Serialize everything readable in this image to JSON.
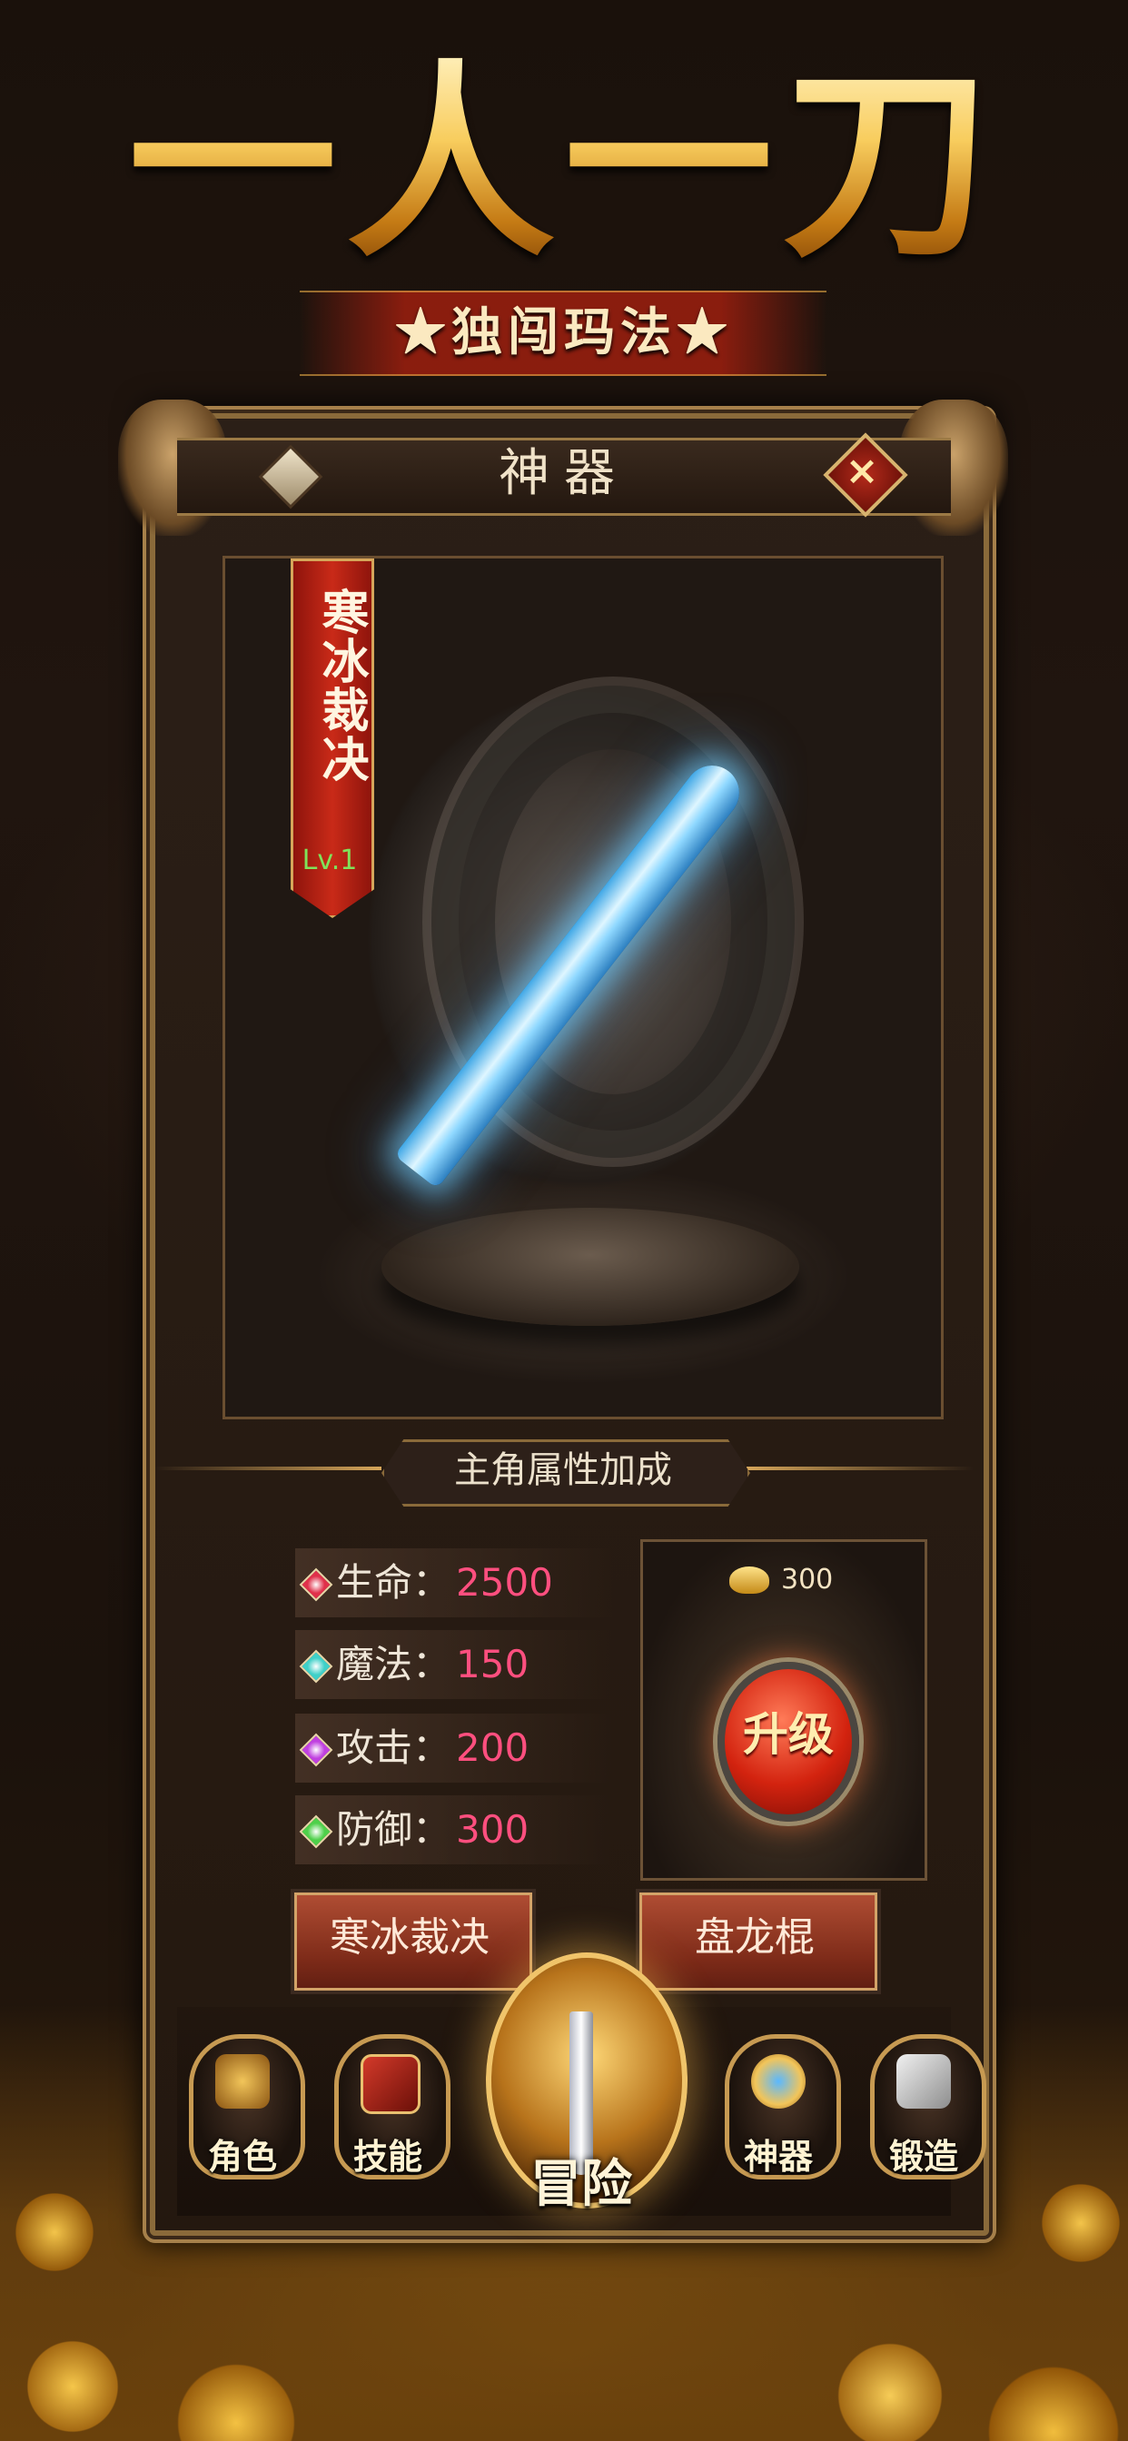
{
  "hero": {
    "title": "一人一刀",
    "subtitle": "★独闯玛法★"
  },
  "panel": {
    "title": "神器",
    "close_icon": "close-icon"
  },
  "artifact": {
    "name": "寒冰裁决",
    "level": "Lv.1"
  },
  "attributes": {
    "header": "主角属性加成",
    "stats": [
      {
        "label": "生命：",
        "value": "2500",
        "gem_color": "#e0304a"
      },
      {
        "label": "魔法：",
        "value": "150",
        "gem_color": "#3fd0c8"
      },
      {
        "label": "攻击：",
        "value": "200",
        "gem_color": "#c040e0"
      },
      {
        "label": "防御：",
        "value": "300",
        "gem_color": "#4ed04a"
      }
    ]
  },
  "upgrade": {
    "cost": "300",
    "button_label": "升级"
  },
  "switch": {
    "left_label": "寒冰裁决",
    "right_label": "盘龙棍"
  },
  "nav": {
    "items": [
      {
        "label": "角色",
        "icon": "helmet-icon"
      },
      {
        "label": "技能",
        "icon": "skill-book-icon"
      },
      {
        "label": "冒险",
        "icon": "sword-emblem-icon"
      },
      {
        "label": "神器",
        "icon": "artifact-icon"
      },
      {
        "label": "锻造",
        "icon": "anvil-icon"
      }
    ]
  },
  "colors": {
    "accent_gold": "#f7c45b",
    "stat_value": "#ff4f7f",
    "level_green": "#7fe25a",
    "banner_red": "#c92a18"
  }
}
